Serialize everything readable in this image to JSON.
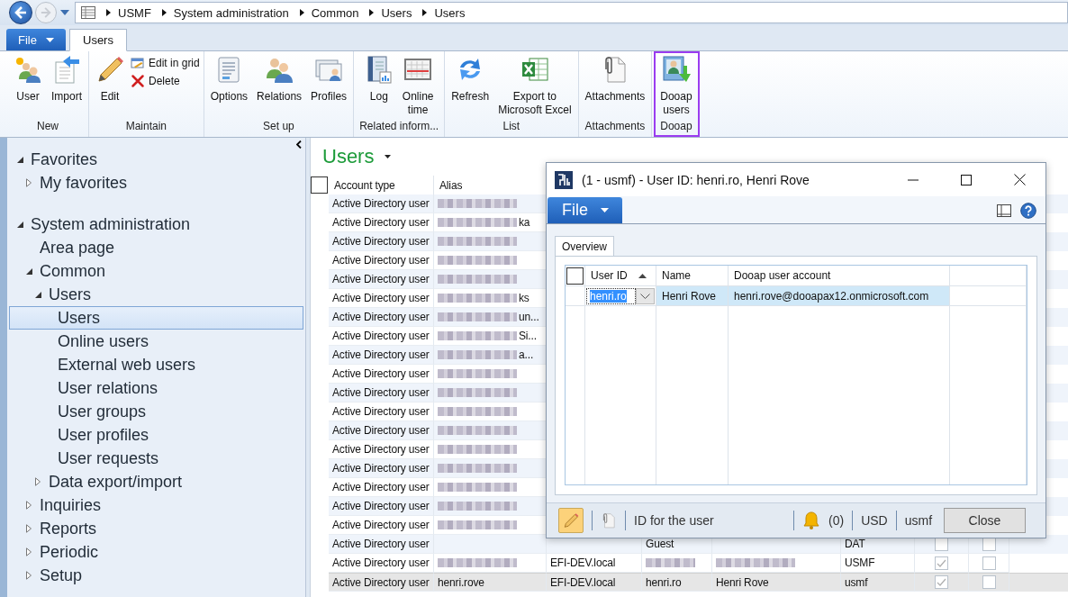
{
  "address_bar": {
    "breadcrumb": [
      "USMF",
      "System administration",
      "Common",
      "Users",
      "Users"
    ]
  },
  "ribbon": {
    "tabs": [
      {
        "label": "File",
        "kind": "menu",
        "selected": false
      },
      {
        "label": "Users",
        "kind": "tab",
        "selected": true
      }
    ],
    "groups": [
      {
        "label": "New",
        "highlighted": false,
        "buttons": [
          {
            "lines": [
              "User"
            ],
            "kind": "large"
          },
          {
            "lines": [
              "Import"
            ],
            "kind": "large"
          }
        ]
      },
      {
        "label": "Maintain",
        "highlighted": false,
        "buttons": [
          {
            "lines": [
              "Edit"
            ],
            "kind": "large"
          },
          {
            "lines": [
              "Edit in grid"
            ],
            "kind": "small"
          },
          {
            "lines": [
              "Delete"
            ],
            "kind": "small"
          }
        ]
      },
      {
        "label": "Set up",
        "highlighted": false,
        "buttons": [
          {
            "lines": [
              "Options"
            ],
            "kind": "large"
          },
          {
            "lines": [
              "Relations"
            ],
            "kind": "large"
          },
          {
            "lines": [
              "Profiles"
            ],
            "kind": "large"
          }
        ]
      },
      {
        "label": "Related inform...",
        "highlighted": false,
        "buttons": [
          {
            "lines": [
              "Log"
            ],
            "kind": "large"
          },
          {
            "lines": [
              "Online",
              "time"
            ],
            "kind": "large"
          }
        ]
      },
      {
        "label": "List",
        "highlighted": false,
        "buttons": [
          {
            "lines": [
              "Refresh"
            ],
            "kind": "large"
          },
          {
            "lines": [
              "Export to",
              "Microsoft Excel"
            ],
            "kind": "large"
          }
        ]
      },
      {
        "label": "Attachments",
        "highlighted": false,
        "buttons": [
          {
            "lines": [
              "Attachments"
            ],
            "kind": "large"
          }
        ]
      },
      {
        "label": "Dooap",
        "highlighted": true,
        "buttons": [
          {
            "lines": [
              "Dooap",
              "users"
            ],
            "kind": "large"
          }
        ]
      }
    ]
  },
  "navigation": {
    "items": [
      {
        "label": "Favorites",
        "expanded": true,
        "selected": false,
        "children": [
          {
            "label": "My favorites",
            "expanded": false,
            "selected": false
          }
        ]
      },
      {
        "label": "System administration",
        "expanded": true,
        "selected": false,
        "children": [
          {
            "label": "Area page",
            "selected": false
          },
          {
            "label": "Common",
            "expanded": true,
            "selected": false,
            "children": [
              {
                "label": "Users",
                "expanded": true,
                "selected": false,
                "children": [
                  {
                    "label": "Users",
                    "selected": true
                  },
                  {
                    "label": "Online users",
                    "selected": false
                  },
                  {
                    "label": "External web users",
                    "selected": false
                  },
                  {
                    "label": "User relations",
                    "selected": false
                  },
                  {
                    "label": "User groups",
                    "selected": false
                  },
                  {
                    "label": "User profiles",
                    "selected": false
                  },
                  {
                    "label": "User requests",
                    "selected": false
                  }
                ]
              },
              {
                "label": "Data export/import",
                "expanded": false,
                "selected": false
              }
            ]
          },
          {
            "label": "Inquiries",
            "expanded": false,
            "selected": false
          },
          {
            "label": "Reports",
            "expanded": false,
            "selected": false
          },
          {
            "label": "Periodic",
            "expanded": false,
            "selected": false
          },
          {
            "label": "Setup",
            "expanded": false,
            "selected": false
          }
        ]
      }
    ]
  },
  "users": {
    "title": "Users",
    "select_all": {
      "checked": false
    },
    "columns": [
      {
        "label": "Account type"
      },
      {
        "label": "Alias"
      }
    ],
    "rows": [
      {
        "account_type": "Active Directory user",
        "alias_blurred": true,
        "selected": false
      },
      {
        "account_type": "Active Directory user",
        "alias_blurred": true,
        "alias": "ka",
        "selected": false
      },
      {
        "account_type": "Active Directory user",
        "alias_blurred": true,
        "selected": false
      },
      {
        "account_type": "Active Directory user",
        "alias_blurred": true,
        "selected": false
      },
      {
        "account_type": "Active Directory user",
        "alias_blurred": true,
        "selected": false
      },
      {
        "account_type": "Active Directory user",
        "alias_blurred": true,
        "alias": "ks",
        "selected": false
      },
      {
        "account_type": "Active Directory user",
        "alias_blurred": true,
        "alias": "un...",
        "selected": false
      },
      {
        "account_type": "Active Directory user",
        "alias_blurred": true,
        "alias": "Si...",
        "selected": false
      },
      {
        "account_type": "Active Directory user",
        "alias_blurred": true,
        "alias": "a...",
        "selected": false
      },
      {
        "account_type": "Active Directory user",
        "alias_blurred": true,
        "selected": false
      },
      {
        "account_type": "Active Directory user",
        "alias_blurred": true,
        "selected": false
      },
      {
        "account_type": "Active Directory user",
        "alias_blurred": true,
        "selected": false
      },
      {
        "account_type": "Active Directory user",
        "alias_blurred": true,
        "selected": false
      },
      {
        "account_type": "Active Directory user",
        "alias_blurred": true,
        "selected": false
      },
      {
        "account_type": "Active Directory user",
        "alias_blurred": true,
        "selected": false
      },
      {
        "account_type": "Active Directory user",
        "alias_blurred": true,
        "selected": false
      },
      {
        "account_type": "Active Directory user",
        "alias_blurred": true,
        "selected": false
      },
      {
        "account_type": "Active Directory user",
        "alias_blurred": true,
        "selected": false
      },
      {
        "account_type": "Active Directory user",
        "user_id": "Guest",
        "company": "DAT",
        "check_1": false,
        "check_2": false,
        "selected": false
      },
      {
        "account_type": "Active Directory user",
        "alias_blurred": true,
        "domain": "EFI-DEV.local",
        "user_id_blurred": true,
        "name_blurred": true,
        "company": "USMF",
        "check_1": true,
        "check_2": false,
        "selected": false
      },
      {
        "account_type": "Active Directory user",
        "alias": "henri.rove",
        "domain": "EFI-DEV.local",
        "user_id": "henri.ro",
        "name": "Henri Rove",
        "company": "usmf",
        "check_1": true,
        "check_2": false,
        "selected": true
      }
    ]
  },
  "dialog": {
    "title": "(1 - usmf) - User ID: henri.ro, Henri Rove",
    "file_button": "File",
    "tabs": [
      {
        "label": "Overview",
        "selected": true
      }
    ],
    "grid": {
      "select_all": {
        "checked": false
      },
      "columns": [
        {
          "label": "User ID",
          "sorted_ascending": true
        },
        {
          "label": "Name"
        },
        {
          "label": "Dooap user account"
        }
      ],
      "rows": [
        {
          "user_id": "henri.ro",
          "name": "Henri Rove",
          "account": "henri.rove@dooapax12.onmicrosoft.com",
          "selected": true
        }
      ]
    },
    "status_bar": {
      "edit_mode": true,
      "help_text": "ID for the user",
      "notifications": "(0)",
      "currency": "USD",
      "company": "usmf"
    },
    "close_button": "Close"
  }
}
